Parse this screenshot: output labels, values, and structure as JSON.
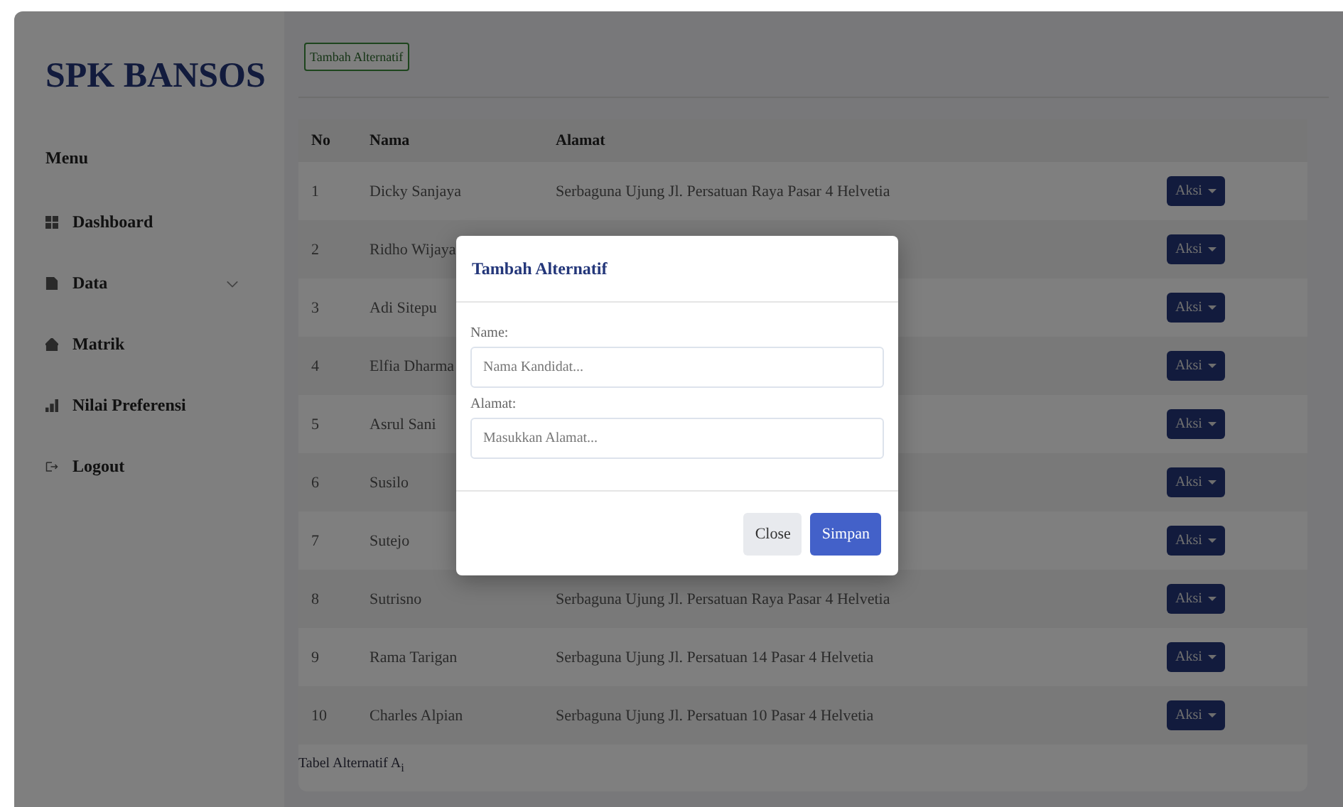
{
  "brand": "SPK BANSOS",
  "sidebar": {
    "heading": "Menu",
    "items": [
      {
        "label": "Dashboard"
      },
      {
        "label": "Data",
        "expanded": false
      },
      {
        "label": "Matrik"
      },
      {
        "label": "Nilai Preferensi"
      },
      {
        "label": "Logout"
      }
    ]
  },
  "add_button": "Tambah Alternatif",
  "table": {
    "columns": [
      "No",
      "Nama",
      "Alamat"
    ],
    "rows": [
      {
        "no": "1",
        "nama": "Dicky Sanjaya",
        "alamat": "Serbaguna Ujung Jl. Persatuan Raya Pasar 4 Helvetia",
        "action": "Aksi"
      },
      {
        "no": "2",
        "nama": "Ridho Wijaya",
        "action": "Aksi"
      },
      {
        "no": "3",
        "nama": "Adi Sitepu",
        "action": "Aksi"
      },
      {
        "no": "4",
        "nama": "Elfia Dharma",
        "action": "Aksi"
      },
      {
        "no": "5",
        "nama": "Asrul Sani",
        "action": "Aksi"
      },
      {
        "no": "6",
        "nama": "Susilo",
        "action": "Aksi"
      },
      {
        "no": "7",
        "nama": "Sutejo",
        "action": "Aksi"
      },
      {
        "no": "8",
        "nama": "Sutrisno",
        "alamat": "Serbaguna Ujung Jl. Persatuan Raya Pasar 4 Helvetia",
        "action": "Aksi"
      },
      {
        "no": "9",
        "nama": "Rama Tarigan",
        "alamat": "Serbaguna Ujung Jl. Persatuan 14 Pasar 4 Helvetia",
        "action": "Aksi"
      },
      {
        "no": "10",
        "nama": "Charles Alpian",
        "alamat": "Serbaguna Ujung Jl. Persatuan 10 Pasar 4 Helvetia",
        "action": "Aksi"
      }
    ],
    "caption": "Tabel Alternatif A$_{i}$"
  },
  "modal": {
    "title": "Tambah Alternatif",
    "fields": [
      {
        "label": "Name:",
        "placeholder": "Nama Kandidat..."
      },
      {
        "label": "Alamat:",
        "placeholder": "Masukkan Alamat..."
      }
    ],
    "buttons": [
      {
        "label": "Close",
        "kind": "secondary"
      },
      {
        "label": "Simpan",
        "kind": "primary"
      }
    ]
  }
}
